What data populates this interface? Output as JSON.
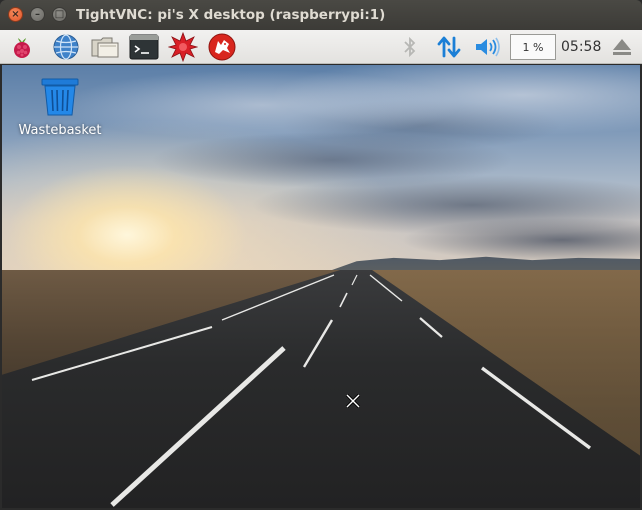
{
  "window": {
    "title": "TightVNC: pi's X desktop (raspberrypi:1)",
    "controls": {
      "close": "×",
      "minimize": "–",
      "maximize": "□"
    }
  },
  "panel": {
    "launchers": [
      {
        "name": "menu",
        "icon": "raspberry-icon"
      },
      {
        "name": "web-browser",
        "icon": "globe-icon"
      },
      {
        "name": "file-manager",
        "icon": "folder-icon"
      },
      {
        "name": "terminal",
        "icon": "terminal-icon"
      },
      {
        "name": "mathematica",
        "icon": "mathematica-icon"
      },
      {
        "name": "wolfram",
        "icon": "wolfram-icon"
      }
    ],
    "tray": {
      "bluetooth_icon": "bluetooth-icon",
      "network_icon": "network-updown-icon",
      "volume_icon": "volume-icon",
      "cpu_usage": "1 %",
      "clock": "05:58",
      "eject_icon": "eject-icon"
    }
  },
  "desktop": {
    "icons": [
      {
        "label": "Wastebasket",
        "icon": "trash-icon"
      }
    ],
    "colors": {
      "panel_bg": "#efeeec",
      "titlebar_bg": "#3c3b37",
      "accent_blue": "#1b7fd6"
    }
  }
}
